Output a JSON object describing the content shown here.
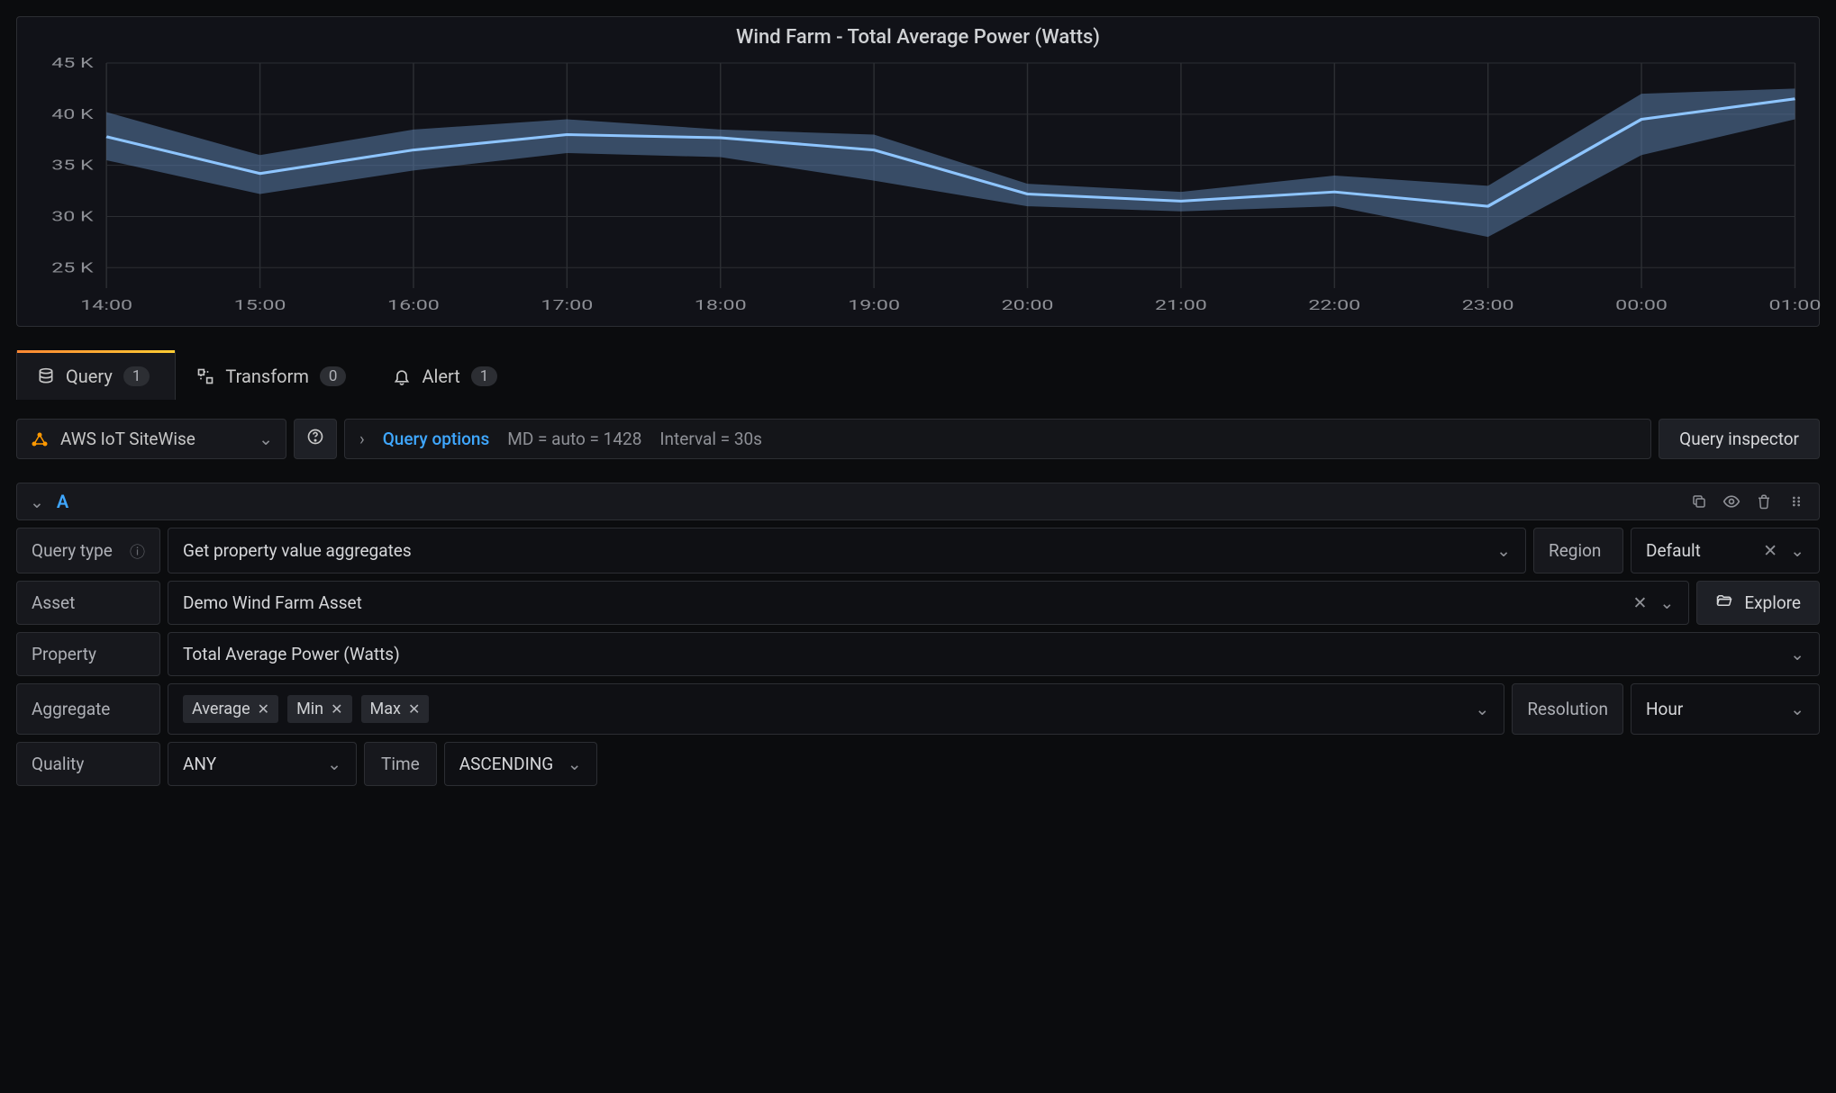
{
  "chart_data": {
    "type": "area",
    "title": "Wind Farm - Total Average Power (Watts)",
    "xlabel": "",
    "ylabel": "",
    "ylim": [
      23000,
      45000
    ],
    "y_ticks": [
      25000,
      30000,
      35000,
      40000,
      45000
    ],
    "y_tick_labels": [
      "25 K",
      "30 K",
      "35 K",
      "40 K",
      "45 K"
    ],
    "categories": [
      "14:00",
      "15:00",
      "16:00",
      "17:00",
      "18:00",
      "19:00",
      "20:00",
      "21:00",
      "22:00",
      "23:00",
      "00:00",
      "01:00"
    ],
    "series": [
      {
        "name": "Average",
        "values": [
          37800,
          34200,
          36500,
          38000,
          37700,
          36500,
          32200,
          31500,
          32400,
          31000,
          39500,
          41500
        ]
      },
      {
        "name": "Min",
        "values": [
          35500,
          32200,
          34500,
          36200,
          35800,
          33500,
          31000,
          30500,
          31000,
          28000,
          36000,
          39500
        ]
      },
      {
        "name": "Max",
        "values": [
          40200,
          36000,
          38500,
          39500,
          38500,
          38000,
          33200,
          32400,
          34000,
          33000,
          42000,
          42500
        ]
      }
    ]
  },
  "tabs": {
    "query": {
      "label": "Query",
      "count": "1"
    },
    "transform": {
      "label": "Transform",
      "count": "0"
    },
    "alert": {
      "label": "Alert",
      "count": "1"
    }
  },
  "toolbar": {
    "datasource": "AWS IoT SiteWise",
    "query_options_label": "Query options",
    "md_text": "MD = auto = 1428",
    "interval_text": "Interval = 30s",
    "inspector_label": "Query inspector"
  },
  "query": {
    "name": "A",
    "labels": {
      "query_type": "Query type",
      "region": "Region",
      "asset": "Asset",
      "explore": "Explore",
      "property": "Property",
      "aggregate": "Aggregate",
      "resolution": "Resolution",
      "quality": "Quality",
      "time": "Time"
    },
    "values": {
      "query_type": "Get property value aggregates",
      "region": "Default",
      "asset": "Demo Wind Farm Asset",
      "property": "Total Average Power (Watts)",
      "aggregates": [
        "Average",
        "Min",
        "Max"
      ],
      "resolution": "Hour",
      "quality": "ANY",
      "time": "ASCENDING"
    }
  }
}
